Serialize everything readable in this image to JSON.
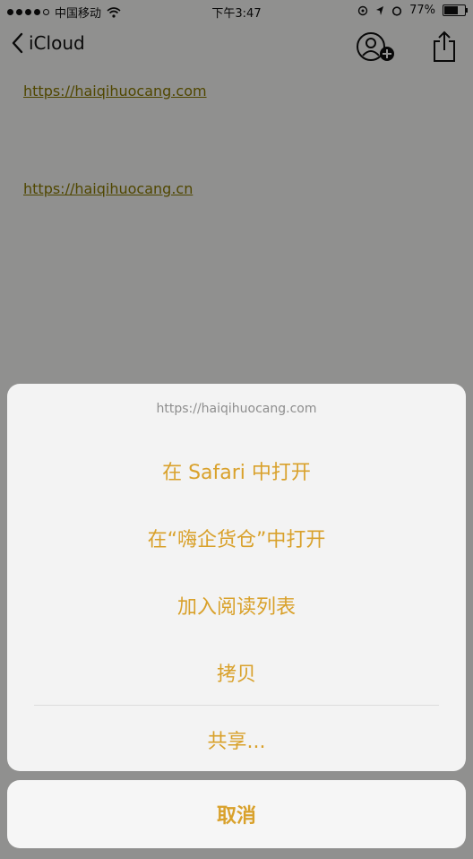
{
  "status_bar": {
    "carrier": "中国移动",
    "time": "下午3:47",
    "battery": "77%",
    "battery_level": 0.77
  },
  "nav": {
    "back_label": "iCloud",
    "icons": [
      "back-chevron-icon",
      "add-person-icon",
      "share-icon"
    ]
  },
  "note": {
    "links": [
      "https://haiqihuocang.com",
      "https://haiqihuocang.cn"
    ]
  },
  "action_sheet": {
    "title": "https://haiqihuocang.com",
    "items": [
      "在 Safari 中打开",
      "在“嗨企货仓”中打开",
      "加入阅读列表",
      "拷贝",
      "共享..."
    ],
    "cancel_label": "取消"
  },
  "colors": {
    "accent": "#d9a12b",
    "link": "#8a7a00",
    "sheet_bg": "#f3f3f3",
    "dim_overlay": "rgba(0,0,0,0.42)"
  }
}
